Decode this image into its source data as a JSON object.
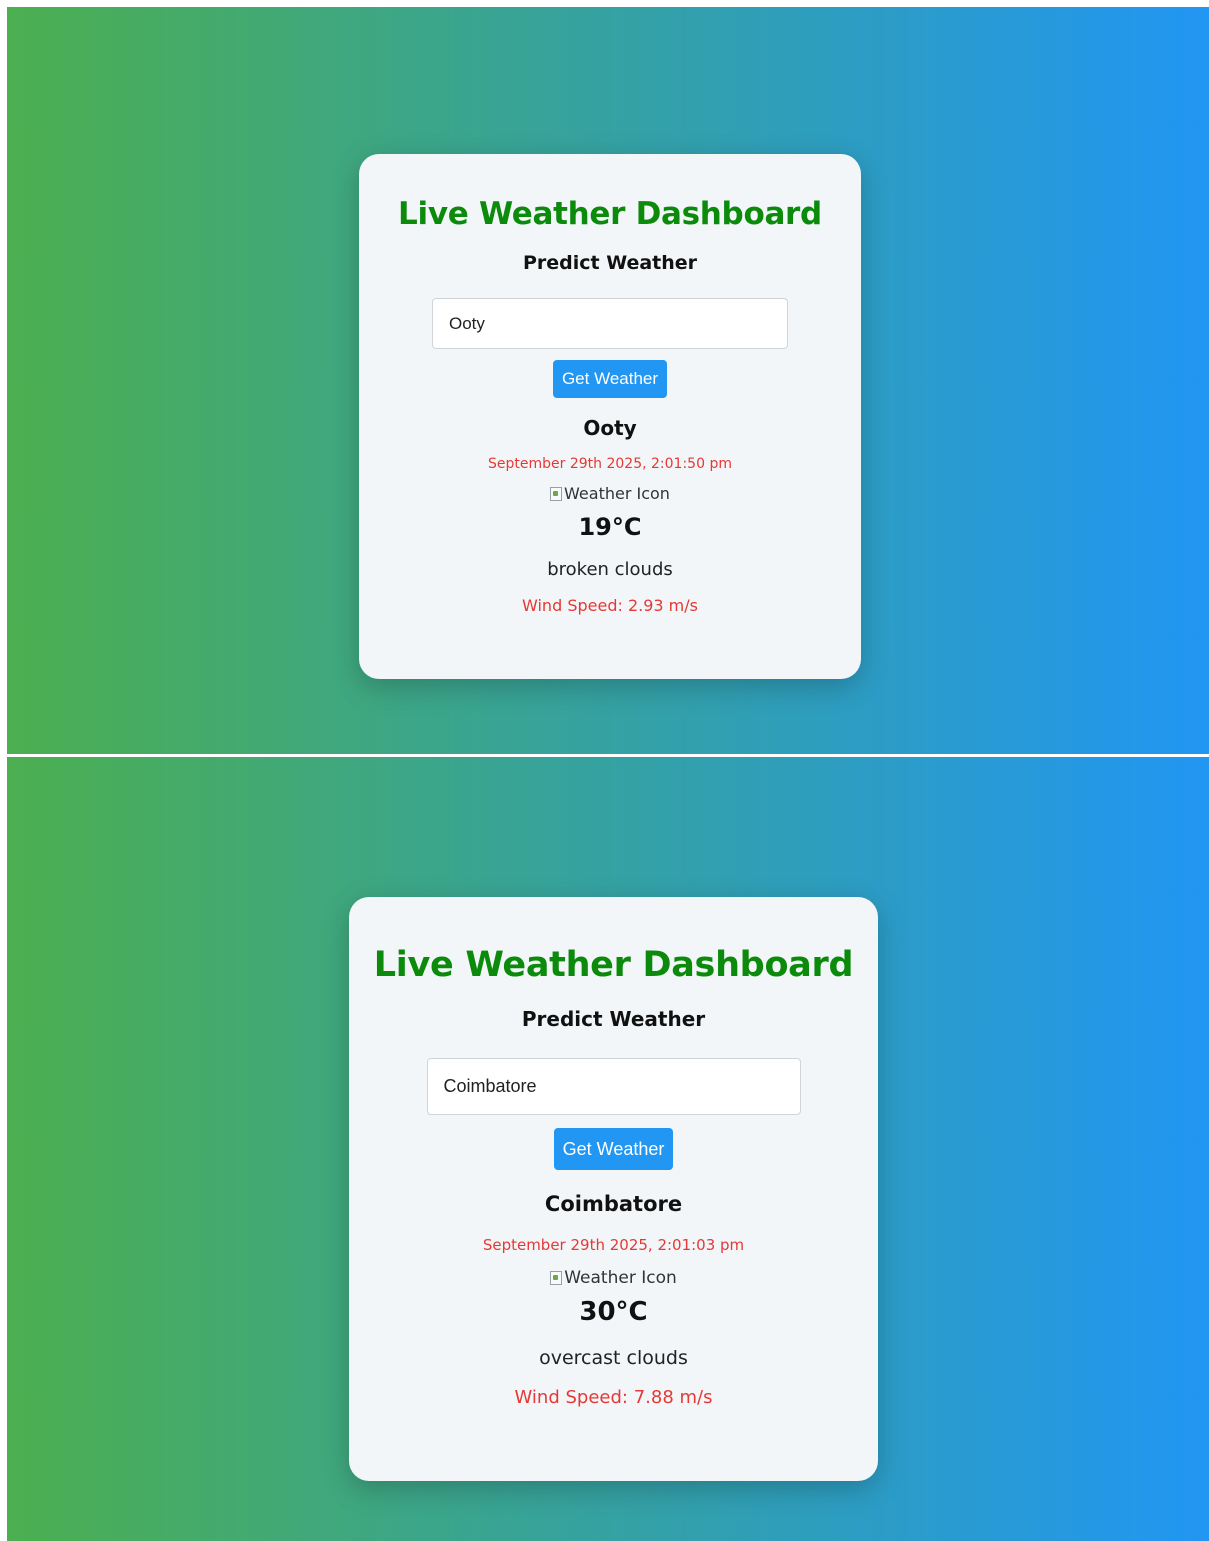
{
  "app": {
    "title": "Live Weather Dashboard",
    "subtitle": "Predict Weather",
    "button_label": "Get Weather"
  },
  "colors": {
    "title_green": "#0b8a0b",
    "accent_blue": "#2196f3",
    "alert_red": "#e53935",
    "gradient_start": "#4caf50",
    "gradient_end": "#2196f3"
  },
  "views": [
    {
      "input_value": "Ooty",
      "city": "Ooty",
      "datetime": "September 29th 2025, 2:01:50 pm",
      "icon_alt": "Weather Icon",
      "temperature": "19°C",
      "description": "broken clouds",
      "wind_label": "Wind Speed:",
      "wind_value": "2.93 m/s"
    },
    {
      "input_value": "Coimbatore",
      "city": "Coimbatore",
      "datetime": "September 29th 2025, 2:01:03 pm",
      "icon_alt": "Weather Icon",
      "temperature": "30°C",
      "description": "overcast clouds",
      "wind_label": "Wind Speed:",
      "wind_value": "7.88 m/s"
    }
  ]
}
